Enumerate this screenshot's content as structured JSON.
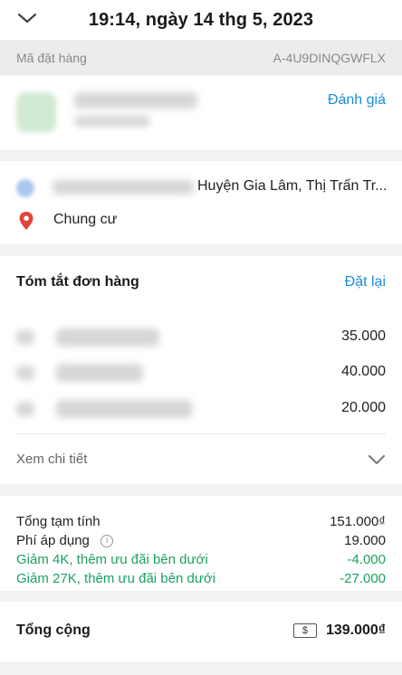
{
  "header": {
    "title": "19:14, ngày 14 thg 5, 2023",
    "back_icon": "chevron-down-icon"
  },
  "order": {
    "label": "Mã đặt hàng",
    "code": "A-4U9DINQGWFLX"
  },
  "merchant": {
    "rate_label": "Đánh giá"
  },
  "address": {
    "text": "Huyện Gia Lâm, Thị Trấn Tr...",
    "place_name": "Chung cư",
    "pin_color": "#e0453a"
  },
  "summary": {
    "title": "Tóm tắt đơn hàng",
    "reorder_label": "Đặt lại",
    "items": [
      {
        "price": "35.000"
      },
      {
        "price": "40.000"
      },
      {
        "price": "20.000"
      }
    ],
    "detail_label": "Xem chi tiết"
  },
  "totals": {
    "subtotal_label": "Tổng tạm tính",
    "subtotal_value": "151.000₫",
    "fee_label": "Phí áp dụng",
    "fee_value": "19.000",
    "discount1_label": "Giảm 4K, thêm ưu đãi bên dưới",
    "discount1_value": "-4.000",
    "discount2_label": "Giảm 27K, thêm ưu đãi bên dưới",
    "discount2_value": "-27.000",
    "grand_label": "Tổng cộng",
    "grand_value": "139.000₫",
    "payment_icon": "$"
  },
  "colors": {
    "accent_link": "#1c8ed6",
    "discount_green": "#1aa260"
  }
}
